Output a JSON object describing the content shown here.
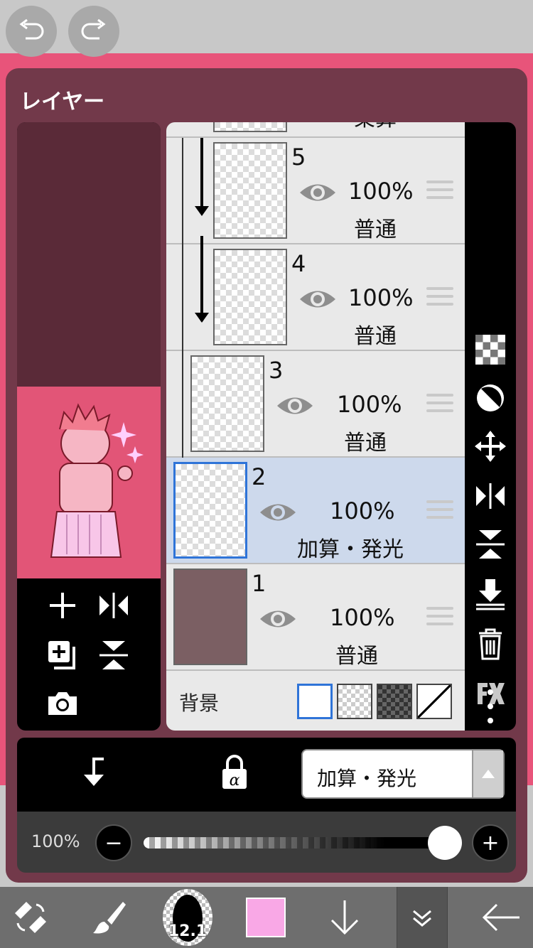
{
  "panel": {
    "title": "レイヤー"
  },
  "layers": [
    {
      "number": "5",
      "opacity": "100%",
      "blend": "普通",
      "selected": false
    },
    {
      "number": "4",
      "opacity": "100%",
      "blend": "普通",
      "selected": false
    },
    {
      "number": "3",
      "opacity": "100%",
      "blend": "普通",
      "selected": false
    },
    {
      "number": "2",
      "opacity": "100%",
      "blend": "加算・発光",
      "selected": true
    },
    {
      "number": "1",
      "opacity": "100%",
      "blend": "普通",
      "selected": false
    }
  ],
  "partial_layer_blend": "乗算",
  "background_row": {
    "label": "背景",
    "options": [
      "white",
      "transparent",
      "dark-checker",
      "none"
    ],
    "selected": "white"
  },
  "action_bar": {
    "blend_mode": "加算・発光"
  },
  "opacity_control": {
    "label": "100%",
    "value": 1.0
  },
  "bottom_bar": {
    "brush_size": "12.1",
    "color": "#f9a8e6"
  },
  "colors": {
    "accent": "#2f74d8",
    "panel": "#72394a",
    "canvas": "#e8547a",
    "layer1_fill": "#7b5f63"
  },
  "icons": [
    "undo-icon",
    "redo-icon",
    "checker-icon",
    "contrast-icon",
    "move-icon",
    "flip-horizontal-icon",
    "flip-vertical-icon",
    "merge-down-icon",
    "trash-icon",
    "fx-icon",
    "more-icon",
    "clip-icon",
    "alpha-lock-icon",
    "add-layer-icon",
    "duplicate-icon",
    "camera-icon",
    "eye-icon",
    "drag-handle-icon",
    "transform-icon",
    "brush-icon",
    "arrow-down-icon",
    "chevron-double-down-icon",
    "back-arrow-icon"
  ]
}
